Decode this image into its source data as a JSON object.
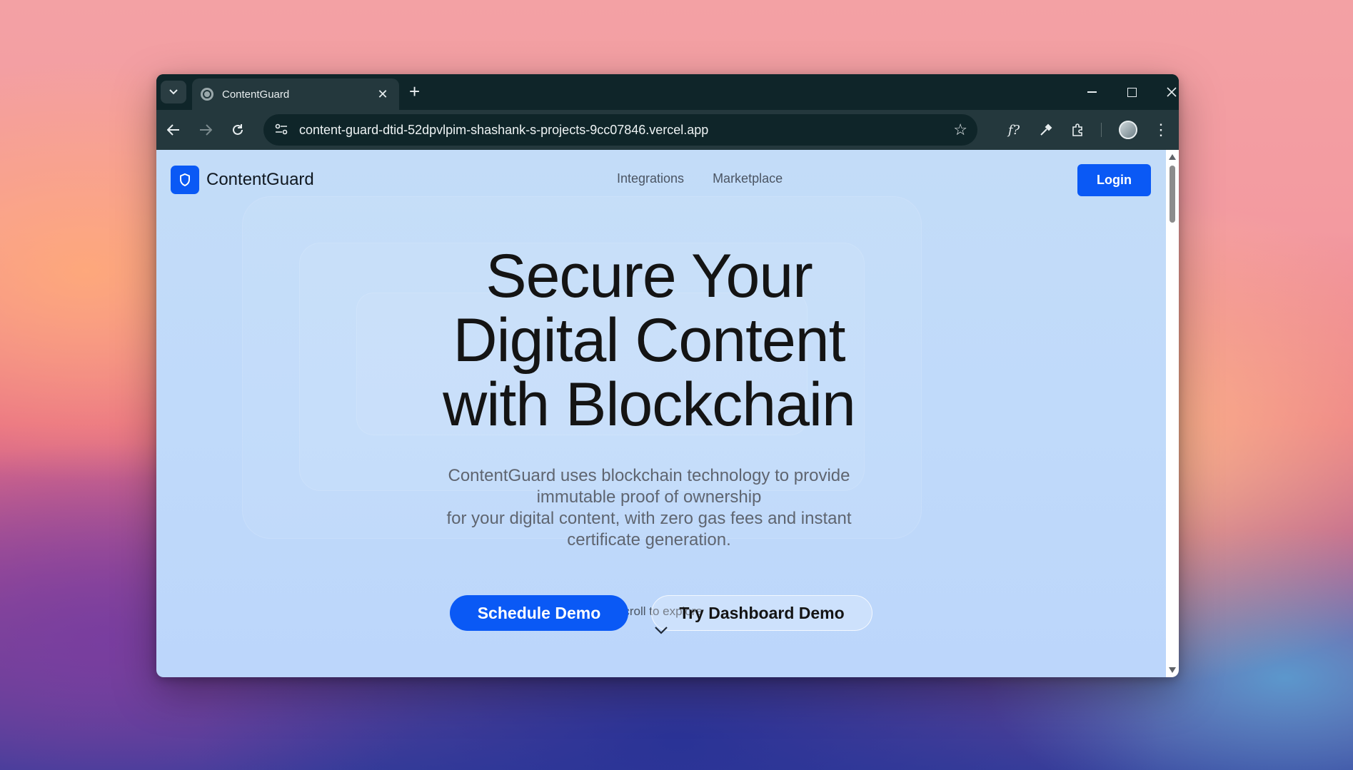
{
  "browser": {
    "tab_title": "ContentGuard",
    "url": "content-guard-dtid-52dpvlpim-shashank-s-projects-9cc07846.vercel.app",
    "icons": {
      "tab_search": "chevron-down-icon",
      "favicon": "globe-icon",
      "tab_close": "close-icon",
      "new_tab": "plus-icon",
      "back": "arrow-left-icon",
      "forward": "arrow-right-icon",
      "reload": "reload-icon",
      "site_info": "tune-icon",
      "bookmark": "star-icon",
      "extensions": [
        "function-icon",
        "eyedropper-icon",
        "puzzle-icon"
      ],
      "profile": "avatar",
      "menu": "kebab-menu-icon"
    }
  },
  "site": {
    "brand": "ContentGuard",
    "nav": [
      "Integrations",
      "Marketplace"
    ],
    "login": "Login",
    "accent": "#0a59f5"
  },
  "hero": {
    "title_lines": [
      "Secure Your",
      "Digital Content",
      "with Blockchain"
    ],
    "subtitle_lines": [
      "ContentGuard uses blockchain technology to provide",
      "immutable proof of ownership",
      "for your digital content, with zero gas fees and instant",
      "certificate generation."
    ],
    "primary_cta": "Schedule Demo",
    "secondary_cta": "Try Dashboard Demo",
    "scroll_hint": "Scroll to explore"
  }
}
